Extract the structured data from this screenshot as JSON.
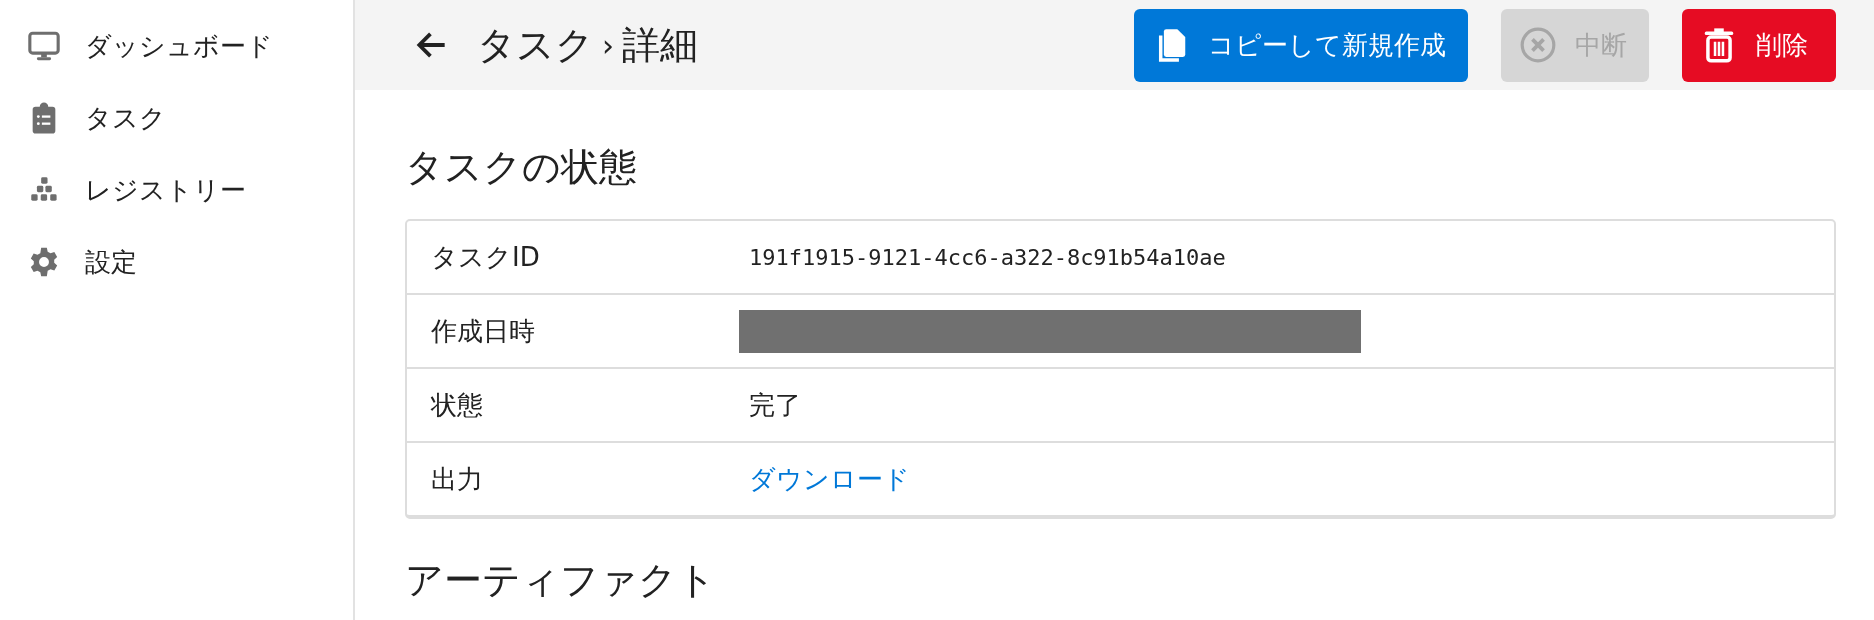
{
  "sidebar": {
    "items": [
      {
        "label": "ダッシュボード"
      },
      {
        "label": "タスク"
      },
      {
        "label": "レジストリー"
      },
      {
        "label": "設定"
      }
    ]
  },
  "header": {
    "breadcrumb": [
      "タスク",
      "詳細"
    ],
    "separator": "›",
    "buttons": [
      {
        "label": "コピーして新規作成",
        "kind": "copy",
        "disabled": false
      },
      {
        "label": "中断",
        "kind": "cancel",
        "disabled": true
      },
      {
        "label": "削除",
        "kind": "delete",
        "disabled": false
      }
    ]
  },
  "sections": [
    {
      "title": "タスクの状態",
      "rows": [
        {
          "label": "タスクID",
          "kind": "mono",
          "value": "191f1915-9121-4cc6-a322-8c91b54a10ae"
        },
        {
          "label": "作成日時",
          "kind": "redacted"
        },
        {
          "label": "状態",
          "kind": "text",
          "value": "完了"
        },
        {
          "label": "出力",
          "kind": "link",
          "value": "ダウンロード"
        }
      ]
    },
    {
      "title": "アーティファクト"
    }
  ]
}
